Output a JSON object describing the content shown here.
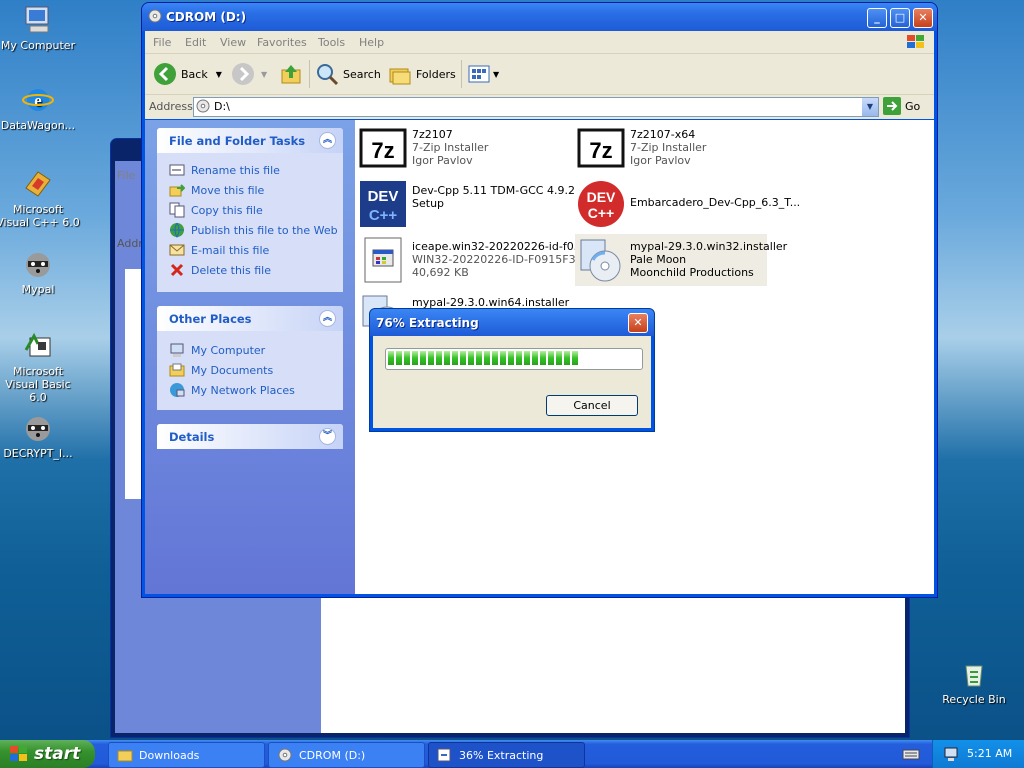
{
  "desktop": {
    "icons": [
      {
        "label": "My Computer"
      },
      {
        "label": "DataWagon..."
      },
      {
        "label": "Microsoft Visual C++ 6.0"
      },
      {
        "label": "Mypal"
      },
      {
        "label": "Microsoft Visual Basic 6.0"
      },
      {
        "label": "DECRYPT_I..."
      },
      {
        "label": "Recycle Bin"
      }
    ]
  },
  "back_window": {
    "file_menu": "File",
    "address_label": "Addr"
  },
  "window": {
    "title": "CDROM (D:)",
    "menu": [
      "File",
      "Edit",
      "View",
      "Favorites",
      "Tools",
      "Help"
    ],
    "toolbar": {
      "back": "Back",
      "search": "Search",
      "folders": "Folders"
    },
    "address": {
      "label": "Address",
      "value": "D:\\",
      "go": "Go"
    },
    "tasks_panel": {
      "title": "File and Folder Tasks",
      "items": [
        "Rename this file",
        "Move this file",
        "Copy this file",
        "Publish this file to the Web",
        "E-mail this file",
        "Delete this file"
      ]
    },
    "places_panel": {
      "title": "Other Places",
      "items": [
        "My Computer",
        "My Documents",
        "My Network Places"
      ]
    },
    "details_panel": {
      "title": "Details"
    },
    "files": [
      {
        "name": "7z2107",
        "line2": "7-Zip Installer",
        "line3": "Igor Pavlov",
        "icon": "7zip-icon"
      },
      {
        "name": "7z2107-x64",
        "line2": "7-Zip Installer",
        "line3": "Igor Pavlov",
        "icon": "7zip-icon"
      },
      {
        "name": "Dev-Cpp 5.11 TDM-GCC 4.9.2",
        "line2": "Setup",
        "line3": "",
        "icon": "devcpp-icon"
      },
      {
        "name": "Embarcadero_Dev-Cpp_6.3_T...",
        "line2": "",
        "line3": "",
        "icon": "embarcadero-devcpp-icon"
      },
      {
        "name": "iceape.win32-20220226-id-f0...",
        "line2": "WIN32-20220226-ID-F0915F3...",
        "line3": "40,692 KB",
        "icon": "installer-window-icon"
      },
      {
        "name": "mypal-29.3.0.win32.installer",
        "line2": "Pale Moon",
        "line3": "Moonchild Productions",
        "icon": "installer-cd-icon"
      },
      {
        "name": "mypal-29.3.0.win64.installer",
        "line2": "",
        "line3": "",
        "icon": "installer-cd-icon"
      }
    ]
  },
  "dialog": {
    "title": "76% Extracting",
    "progress": 0.76,
    "cancel": "Cancel"
  },
  "taskbar": {
    "start": "start",
    "tasks": [
      "Downloads",
      "CDROM (D:)",
      "36% Extracting"
    ],
    "clock": "5:21 AM"
  },
  "colors": {
    "xp_blue": "#0054e3",
    "task_link": "#215dc6",
    "progress_green": "#37c12a"
  }
}
